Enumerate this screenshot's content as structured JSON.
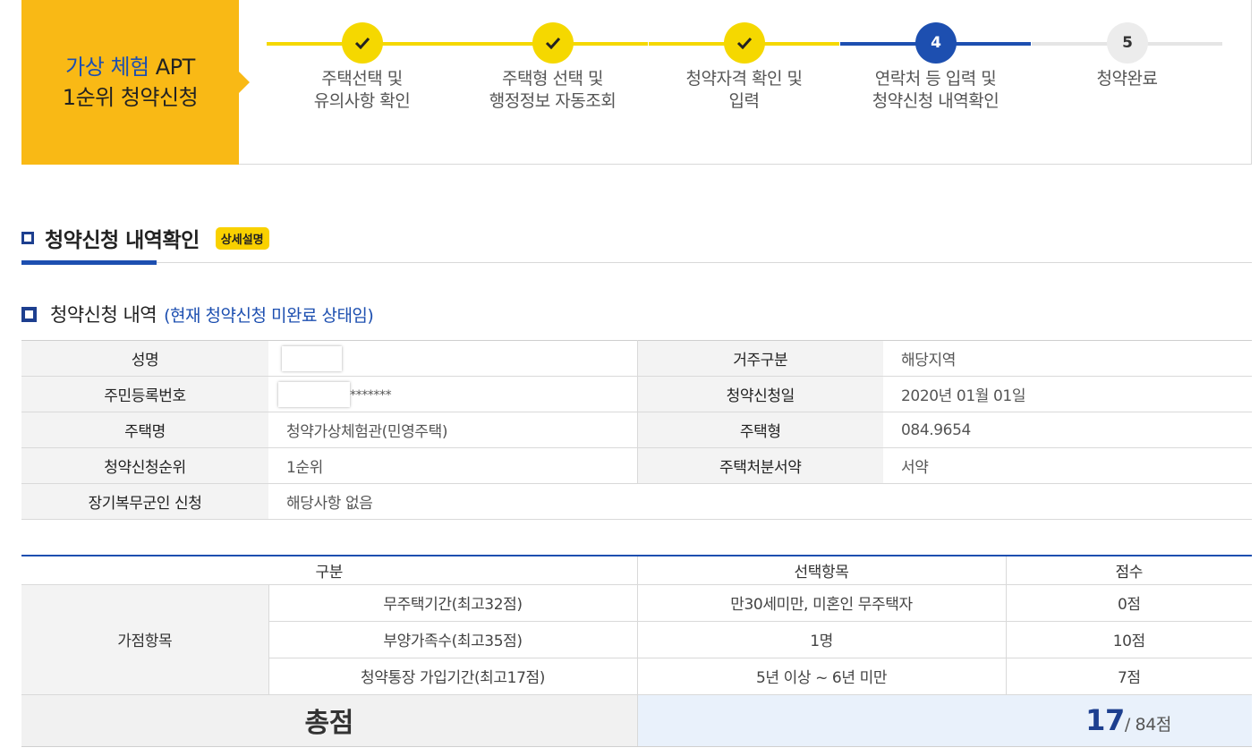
{
  "header": {
    "title_line1_blue": "가상 체험",
    "title_line1_rest": " APT",
    "title_line2": "1순위 청약신청"
  },
  "steps": [
    {
      "label_line1": "주택선택 및",
      "label_line2": "유의사항 확인",
      "state": "done"
    },
    {
      "label_line1": "주택형 선택 및",
      "label_line2": "행정정보 자동조회",
      "state": "done"
    },
    {
      "label_line1": "청약자격 확인 및",
      "label_line2": "입력",
      "state": "done"
    },
    {
      "label_line1": "연락처 등 입력 및",
      "label_line2": "청약신청 내역확인",
      "state": "current",
      "number": "4"
    },
    {
      "label_line1": "청약완료",
      "label_line2": "",
      "state": "todo",
      "number": "5"
    }
  ],
  "section": {
    "title": "청약신청 내역확인",
    "detail_button": "상세설명"
  },
  "subsection": {
    "title": "청약신청 내역",
    "status": "(현재 청약신청 미완료 상태임)"
  },
  "info": {
    "name_label": "성명",
    "residence_label": "거주구분",
    "residence_value": "해당지역",
    "rrn_label": "주민등록번호",
    "rrn_suffix": "*******",
    "apply_date_label": "청약신청일",
    "apply_date_value": "2020년 01월 01일",
    "house_name_label": "주택명",
    "house_name_value": "청약가상체험관(민영주택)",
    "house_type_label": "주택형",
    "house_type_value": "084.9654",
    "rank_label": "청약신청순위",
    "rank_value": "1순위",
    "pledge_label": "주택처분서약",
    "pledge_value": "서약",
    "military_label": "장기복무군인 신청",
    "military_value": "해당사항 없음"
  },
  "score": {
    "col_category": "구분",
    "col_selection": "선택항목",
    "col_points": "점수",
    "group_label": "가점항목",
    "rows": [
      {
        "item": "무주택기간(최고32점)",
        "selection": "만30세미만, 미혼인 무주택자",
        "points": "0점"
      },
      {
        "item": "부양가족수(최고35점)",
        "selection": "1명",
        "points": "10점"
      },
      {
        "item": "청약통장 가입기간(최고17점)",
        "selection": "5년 이상 ~ 6년 미만",
        "points": "7점"
      }
    ],
    "total_label": "총점",
    "total_value": "17",
    "total_max": "/ 84점"
  },
  "colors": {
    "accent_yellow": "#f9b915",
    "step_yellow": "#f5d800",
    "brand_blue": "#1d4fb0",
    "total_bg": "#e9f1fb"
  }
}
